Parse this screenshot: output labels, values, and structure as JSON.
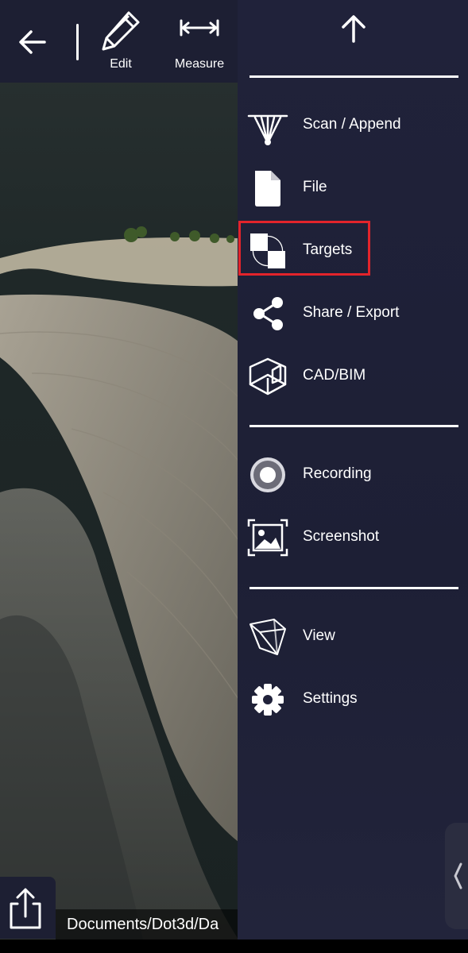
{
  "toolbar": {
    "edit_label": "Edit",
    "measure_label": "Measure"
  },
  "menu": {
    "items": [
      {
        "label": "Scan / Append",
        "icon": "scan-append-icon"
      },
      {
        "label": "File",
        "icon": "file-icon"
      },
      {
        "label": "Targets",
        "icon": "targets-icon",
        "highlighted": true
      },
      {
        "label": "Share / Export",
        "icon": "share-icon"
      },
      {
        "label": "CAD/BIM",
        "icon": "cad-bim-icon"
      },
      {
        "label": "Recording",
        "icon": "recording-icon"
      },
      {
        "label": "Screenshot",
        "icon": "screenshot-icon"
      },
      {
        "label": "View",
        "icon": "view-cube-icon"
      },
      {
        "label": "Settings",
        "icon": "gear-icon"
      }
    ]
  },
  "bottom": {
    "path_text": "Documents/Dot3d/Da"
  },
  "colors": {
    "toolbar_bg": "#1d1f33",
    "menu_bg": "#20223a",
    "highlight": "#e3242b"
  }
}
